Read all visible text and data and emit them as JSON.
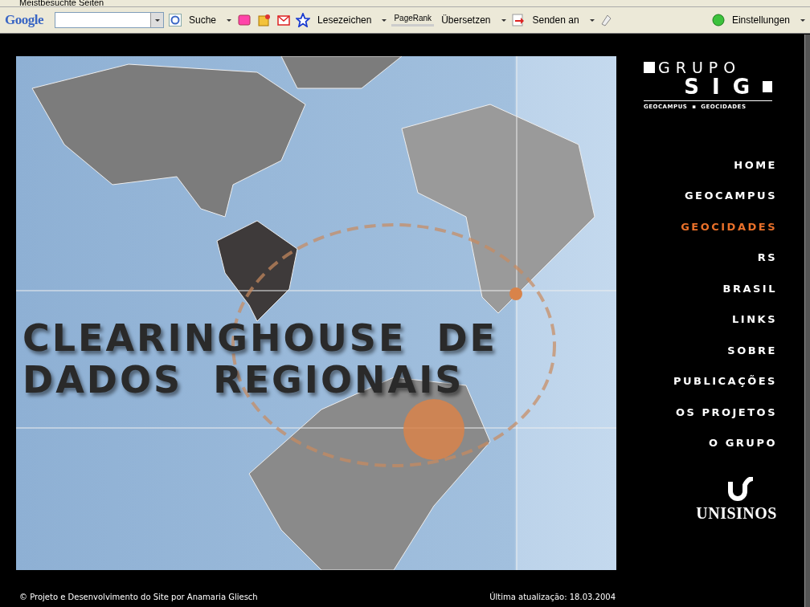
{
  "bookmarks_bar": {
    "item": "Meistbesuchte Seiten"
  },
  "toolbar": {
    "brand": "Google",
    "search_button": "Suche",
    "bookmarks": "Lesezeichen",
    "pagerank": "PageRank",
    "translate": "Übersetzen",
    "send": "Senden an",
    "settings": "Einstellungen"
  },
  "banner": {
    "line_1": "CLEARINGHOUSE  DE",
    "line_2": "DADOS  REGIONAIS"
  },
  "logo": {
    "top": "GRUPO",
    "main": "SIG",
    "subtitle": "GEOCAMPUS  ▪  GEOCIDADES"
  },
  "nav": [
    {
      "label": "HOME",
      "selected": false
    },
    {
      "label": "GEOCAMPUS",
      "selected": false
    },
    {
      "label": "GEOCIDADES",
      "selected": true
    },
    {
      "label": "RS",
      "selected": false
    },
    {
      "label": "BRASIL",
      "selected": false
    },
    {
      "label": "LINKS",
      "selected": false
    },
    {
      "label": "SOBRE",
      "selected": false
    },
    {
      "label": "PUBLICAÇÕES",
      "selected": false
    },
    {
      "label": "OS PROJETOS",
      "selected": false
    },
    {
      "label": "O GRUPO",
      "selected": false
    }
  ],
  "university_logo": {
    "name": "UNISINOS"
  },
  "footer": {
    "credit": "© Projeto e Desenvolvimento do Site por Anamaria Gliesch",
    "updated": "Última atualização: 18.03.2004"
  }
}
